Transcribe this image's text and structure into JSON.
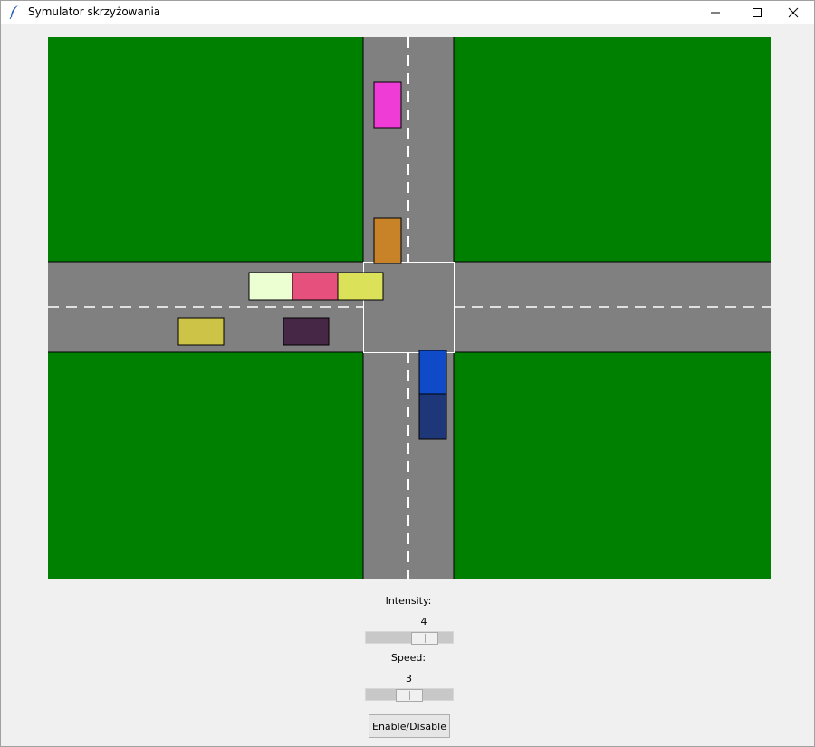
{
  "window": {
    "title": "Symulator skrzyżowania",
    "controls": {
      "minimize": "minimize-icon",
      "maximize": "maximize-icon",
      "close": "close-icon"
    }
  },
  "scene": {
    "colors": {
      "grass": "#008000",
      "road": "#808080",
      "lane_marking": "#ffffff",
      "road_edge": "#000000"
    },
    "vehicles": [
      {
        "name": "car-north-1",
        "color": "#f03cd7",
        "direction": "southbound"
      },
      {
        "name": "car-north-2",
        "color": "#c88228",
        "direction": "southbound"
      },
      {
        "name": "car-west-1",
        "color": "#ebffd2",
        "direction": "eastbound"
      },
      {
        "name": "car-west-2",
        "color": "#e6507d",
        "direction": "eastbound"
      },
      {
        "name": "car-west-3",
        "color": "#dce15a",
        "direction": "eastbound"
      },
      {
        "name": "car-west-4",
        "color": "#cdc346",
        "direction": "westbound"
      },
      {
        "name": "car-west-5",
        "color": "#462846",
        "direction": "westbound"
      },
      {
        "name": "car-south-1",
        "color": "#0f4bc8",
        "direction": "northbound"
      },
      {
        "name": "car-south-2",
        "color": "#1e3778",
        "direction": "northbound"
      }
    ]
  },
  "controls": {
    "intensity": {
      "label": "Intensity:",
      "value": "4",
      "min": 1,
      "max": 5,
      "position": 4
    },
    "speed": {
      "label": "Speed:",
      "value": "3",
      "min": 1,
      "max": 5,
      "position": 3
    },
    "toggle_button": "Enable/Disable"
  }
}
